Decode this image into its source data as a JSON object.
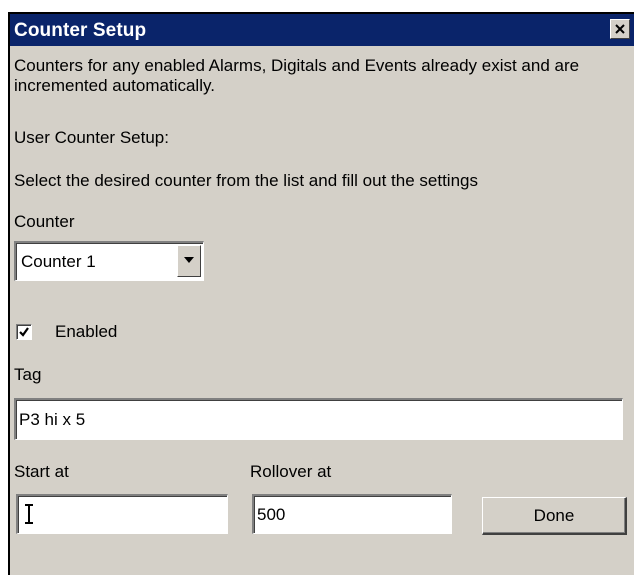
{
  "window": {
    "title": "Counter Setup",
    "close_icon": "close-icon"
  },
  "text": {
    "intro": "Counters for any enabled Alarms, Digitals and Events already exist and are incremented automatically.",
    "user_setup": "User Counter Setup:",
    "instructions": "Select the desired counter from the list and fill out the settings"
  },
  "counter": {
    "label": "Counter",
    "selected": "Counter 1"
  },
  "enabled": {
    "label": "Enabled",
    "checked": true
  },
  "tag": {
    "label": "Tag",
    "value": "P3 hi x 5"
  },
  "start": {
    "label": "Start at",
    "value": ""
  },
  "rollover": {
    "label": "Rollover at",
    "value": "500"
  },
  "buttons": {
    "done": "Done"
  },
  "colors": {
    "titlebar": "#0a246a",
    "dialog_face": "#d4d0c8"
  }
}
